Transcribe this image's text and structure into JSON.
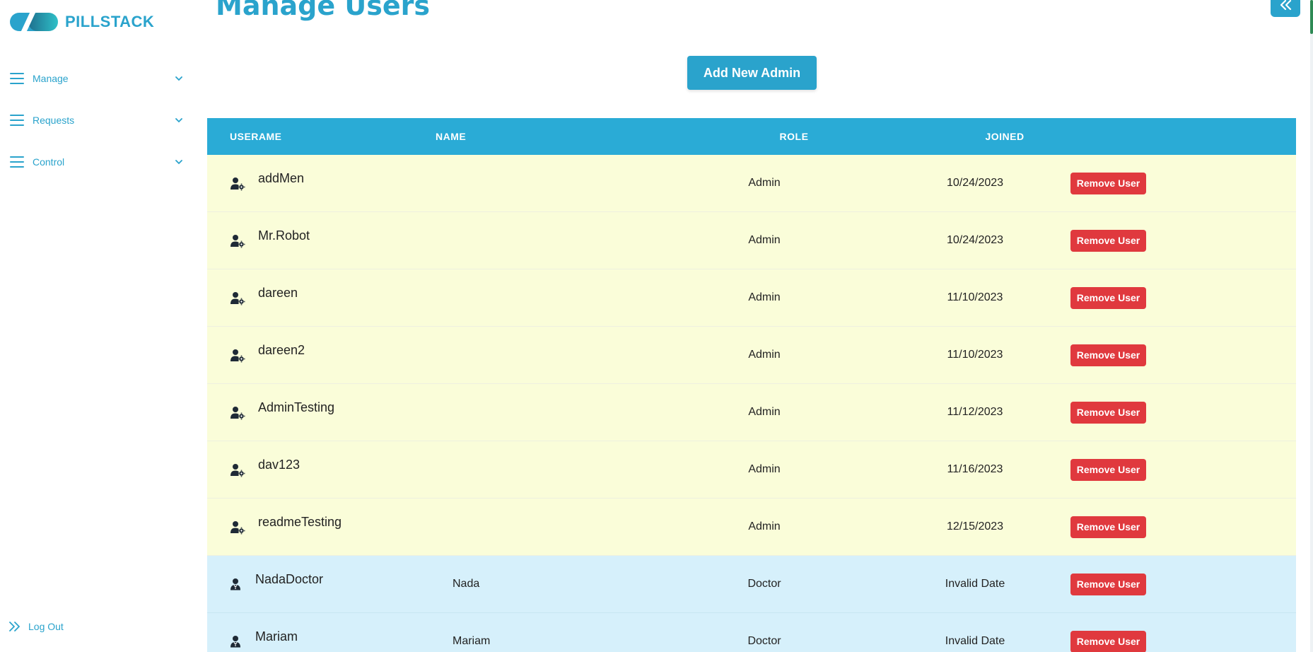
{
  "app": {
    "brand": "PILLSTACK"
  },
  "sidebar": {
    "items": [
      {
        "label": "Manage",
        "icon": "menu-icon"
      },
      {
        "label": "Requests",
        "icon": "menu-icon"
      },
      {
        "label": "Control",
        "icon": "menu-icon"
      }
    ],
    "logout_label": "Log Out"
  },
  "main": {
    "title": "Manage Users",
    "add_button_label": "Add New Admin",
    "table": {
      "headers": [
        "USERAME",
        "NAME",
        "ROLE",
        "JOINED"
      ],
      "action_label": "Remove User",
      "rows": [
        {
          "username": "addMen",
          "name": "",
          "role": "Admin",
          "joined": "10/24/2023",
          "icon": "user-gear-icon"
        },
        {
          "username": "Mr.Robot",
          "name": "",
          "role": "Admin",
          "joined": "10/24/2023",
          "icon": "user-gear-icon"
        },
        {
          "username": "dareen",
          "name": "",
          "role": "Admin",
          "joined": "11/10/2023",
          "icon": "user-gear-icon"
        },
        {
          "username": "dareen2",
          "name": "",
          "role": "Admin",
          "joined": "11/10/2023",
          "icon": "user-gear-icon"
        },
        {
          "username": "AdminTesting",
          "name": "",
          "role": "Admin",
          "joined": "11/12/2023",
          "icon": "user-gear-icon"
        },
        {
          "username": "dav123",
          "name": "",
          "role": "Admin",
          "joined": "11/16/2023",
          "icon": "user-gear-icon"
        },
        {
          "username": "readmeTesting",
          "name": "",
          "role": "Admin",
          "joined": "12/15/2023",
          "icon": "user-gear-icon"
        },
        {
          "username": "NadaDoctor",
          "name": "Nada",
          "role": "Doctor",
          "joined": "Invalid Date",
          "icon": "doctor-icon"
        },
        {
          "username": "Mariam",
          "name": "Mariam",
          "role": "Doctor",
          "joined": "Invalid Date",
          "icon": "doctor-icon"
        }
      ]
    }
  },
  "colors": {
    "accent": "#2aa3cc",
    "header": "#2aabd6",
    "admin_row": "#fafdd9",
    "doctor_row": "#d6f0fb",
    "danger": "#e0393e"
  }
}
